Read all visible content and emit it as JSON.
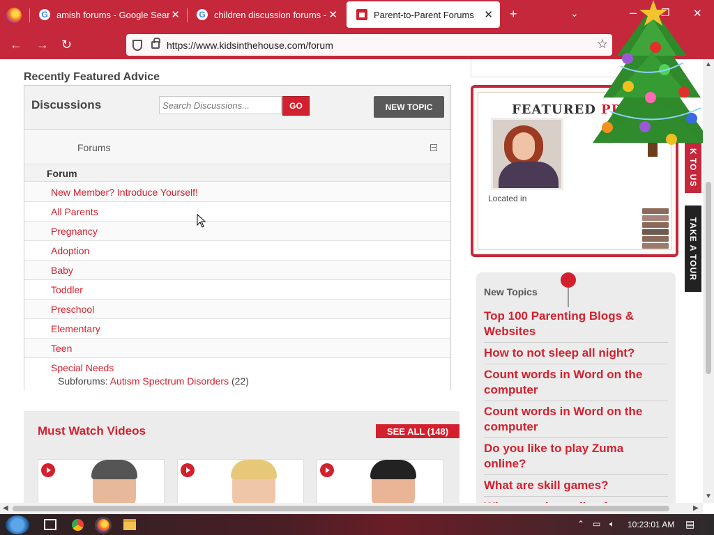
{
  "browser": {
    "tabs": [
      {
        "label": "amish forums - Google Search",
        "icon": "google-icon"
      },
      {
        "label": "children discussion forums - Go",
        "icon": "google-icon"
      },
      {
        "label": "Parent-to-Parent Forums",
        "icon": "house-icon",
        "active": true
      }
    ],
    "url": "https://www.kidsinthehouse.com/forum"
  },
  "main": {
    "section_title": "Recently Featured Advice",
    "discussions": {
      "title": "Discussions",
      "search_placeholder": "Search Discussions...",
      "go_label": "GO",
      "new_topic_label": "NEW TOPIC",
      "forums_label": "Forums",
      "forum_column_header": "Forum",
      "forums": [
        "New Member? Introduce Yourself!",
        "All Parents",
        "Pregnancy",
        "Adoption",
        "Baby",
        "Toddler",
        "Preschool",
        "Elementary",
        "Teen",
        "Special Needs"
      ],
      "subforums_label": "Subforums:",
      "subforum_link": "Autism Spectrum Disorders",
      "subforum_count": "(22)"
    },
    "videos": {
      "title": "Must Watch Videos",
      "see_all_label": "SEE ALL (148)"
    }
  },
  "sidebar": {
    "featured_title_a": "FEATURED ",
    "featured_title_b": "PRO",
    "located_in": "Located in",
    "contact_tab": "K TO US",
    "tour_tab": "TAKE A TOUR",
    "new_topics_title": "New Topics",
    "new_topics": [
      "Top 100 Parenting Blogs & Websites",
      "How to not sleep all night?",
      "Count words in Word on the computer",
      "Count words in Word on the computer",
      "Do you like to play Zuma online?",
      "What are skill games?",
      "Where to play online free"
    ]
  },
  "taskbar": {
    "clock": "10:23:01 AM"
  },
  "colors": {
    "browser_chrome": "#c4283a",
    "brand_red": "#d3202e"
  }
}
